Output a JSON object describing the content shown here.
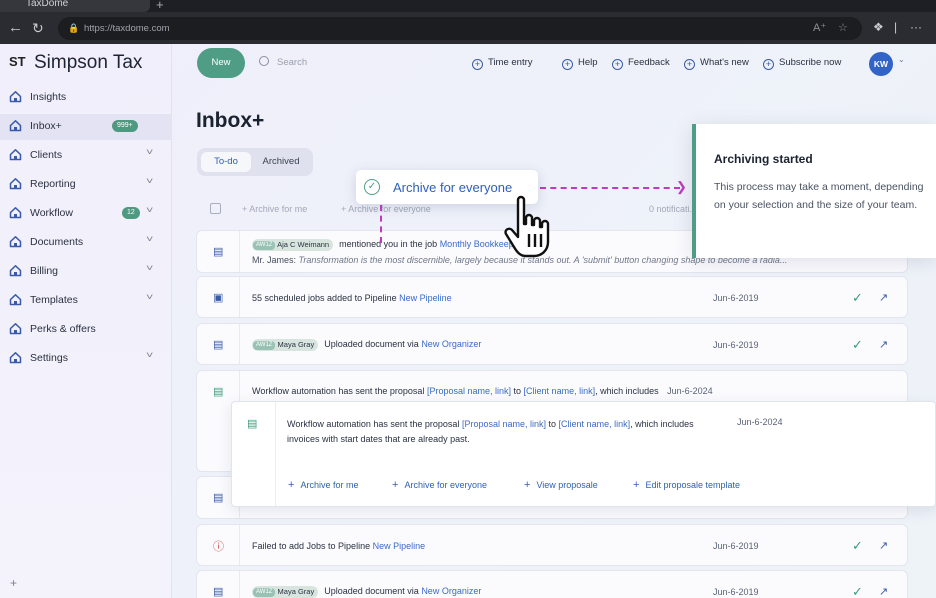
{
  "browser": {
    "tab_title": "TaxDome",
    "url": "https://taxdome.com"
  },
  "brand": {
    "logo": "ST",
    "name": "Simpson Tax"
  },
  "sidebar": {
    "items": [
      {
        "label": "Insights",
        "icon": "home-icon"
      },
      {
        "label": "Inbox+",
        "badge": "999+",
        "icon": "home-icon"
      },
      {
        "label": "Clients",
        "icon": "home-icon",
        "chevron": true
      },
      {
        "label": "Reporting",
        "icon": "home-icon",
        "chevron": true
      },
      {
        "label": "Workflow",
        "badge": "12",
        "icon": "home-icon",
        "chevron": true
      },
      {
        "label": "Documents",
        "icon": "home-icon",
        "chevron": true
      },
      {
        "label": "Billing",
        "icon": "home-icon",
        "chevron": true
      },
      {
        "label": "Templates",
        "icon": "home-icon",
        "chevron": true
      },
      {
        "label": "Perks & offers",
        "icon": "home-icon"
      },
      {
        "label": "Settings",
        "icon": "home-icon",
        "chevron": true
      }
    ]
  },
  "header": {
    "new_label": "New",
    "search_placeholder": "Search",
    "time_entry": "Time entry",
    "help": "Help",
    "feedback": "Feedback",
    "whats_new": "What's new",
    "subscribe": "Subscribe now",
    "avatar": "KW"
  },
  "page": {
    "title": "Inbox+",
    "tab_todo": "To-do",
    "tab_archived": "Archived",
    "archive_for_me": "Archive for me",
    "archive_for_everyone": "Archive for everyone",
    "notifications": "0 notificati..."
  },
  "rows": [
    {
      "tag": "AW1Z",
      "person": "Aja C Weimann",
      "text": "mentioned you in the job",
      "link": "Monthly Bookkeeping",
      "sub_name": "Mr. James:",
      "sub_text": "Transformation is the most discernible, largely because it stands out. A 'submit' button changing shape to become a radia..."
    },
    {
      "text": "55 scheduled jobs added to Pipeline",
      "link": "New Pipeline",
      "date": "Jun-6-2019"
    },
    {
      "tag": "AW1Z",
      "person": "Maya Gray",
      "text": "Uploaded document via",
      "link": "New Organizer",
      "date": "Jun-6-2019"
    },
    {
      "text": "Workflow automation has sent the proposal",
      "link1": "[Proposal name, link]",
      "mid": "to",
      "link2": "[Client name, link]",
      "tail": ", which includes",
      "date": "Jun-6-2024"
    },
    {
      "text": "Failed to add Jobs to Pipeline",
      "link": "New Pipeline",
      "date": "Jun-6-2019"
    },
    {
      "tag": "AW1Z",
      "person": "Maya Gray",
      "text": "Uploaded document via",
      "link": "New Organizer",
      "date": "Jun-6-2019"
    }
  ],
  "card": {
    "text": "Workflow automation has sent the proposal",
    "link1": "[Proposal name, link]",
    "mid": "to",
    "link2": "[Client name, link]",
    "tail": ", which includes",
    "line2": "invoices with start dates that are already past.",
    "date": "Jun-6-2024",
    "actions": [
      "Archive for me",
      "Archive for everyone",
      "View proposale",
      "Edit proposale template"
    ]
  },
  "float_button": {
    "label": "Archive for everyone"
  },
  "toast": {
    "title": "Archiving started",
    "message": "This process may take a moment, depending on your selection and the size of your team."
  },
  "colors": {
    "accent": "#4e9d84",
    "link": "#3a6bc6",
    "highlight": "#c03ac0"
  }
}
